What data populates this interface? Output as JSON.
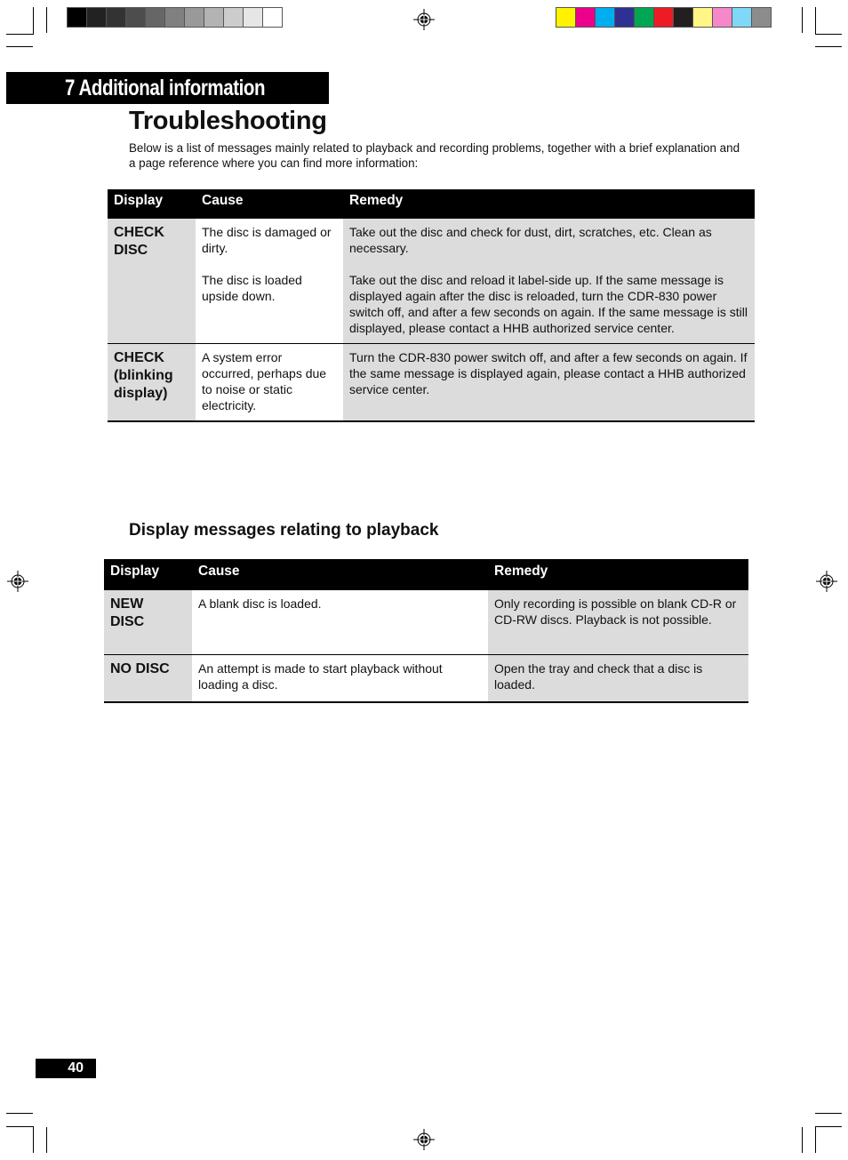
{
  "color_bars": {
    "grayscale": [
      "#000000",
      "#222222",
      "#333333",
      "#4d4d4d",
      "#666666",
      "#808080",
      "#999999",
      "#b3b3b3",
      "#cccccc",
      "#e6e6e6",
      "#ffffff"
    ],
    "process": [
      "#fff200",
      "#ec008c",
      "#00aeef",
      "#2e3192",
      "#00a651",
      "#ed1c24",
      "#231f20",
      "#fff685",
      "#f488c8",
      "#7fd8f7",
      "#8c8c8c"
    ]
  },
  "chapter": {
    "title": "7 Additional information",
    "bar_color": "#000000"
  },
  "page_title": "Troubleshooting",
  "intro": "Below is a list of messages mainly related to playback and recording problems, together with a brief explanation and a page reference where you can find more information:",
  "table1": {
    "headers": [
      "Display",
      "Cause",
      "Remedy"
    ],
    "rows": [
      {
        "display": [
          "CHECK",
          "DISC"
        ],
        "causes": [
          "The disc is damaged or dirty.",
          "The disc is loaded upside down."
        ],
        "remedies": [
          "Take out the disc and check for dust, dirt, scratches, etc. Clean as necessary.",
          "Take out the disc and reload it label-side up. If the same message is displayed again after the disc is reloaded, turn the CDR-830 power switch off, and after a few seconds on again. If the same message is still displayed, please contact a HHB authorized service center."
        ]
      },
      {
        "display": [
          "CHECK",
          "(blinking",
          "display)"
        ],
        "causes": [
          "A system error occurred, perhaps due to noise or static electricity."
        ],
        "remedies": [
          "Turn  the CDR-830 power switch off, and after a few seconds on again. If the same message is displayed again, please contact a HHB authorized service center."
        ]
      }
    ]
  },
  "section2_title": "Display messages relating to playback",
  "table2": {
    "headers": [
      "Display",
      "Cause",
      "Remedy"
    ],
    "rows": [
      {
        "display": [
          "NEW",
          "DISC"
        ],
        "cause": "A blank disc is loaded.",
        "remedy": "Only recording is possible on blank CD-R or CD-RW discs. Playback is not possible."
      },
      {
        "display": [
          "NO DISC"
        ],
        "cause": "An attempt is made to start playback without loading a disc.",
        "remedy": "Open the tray and check that a disc is loaded."
      }
    ]
  },
  "page_number": "40"
}
